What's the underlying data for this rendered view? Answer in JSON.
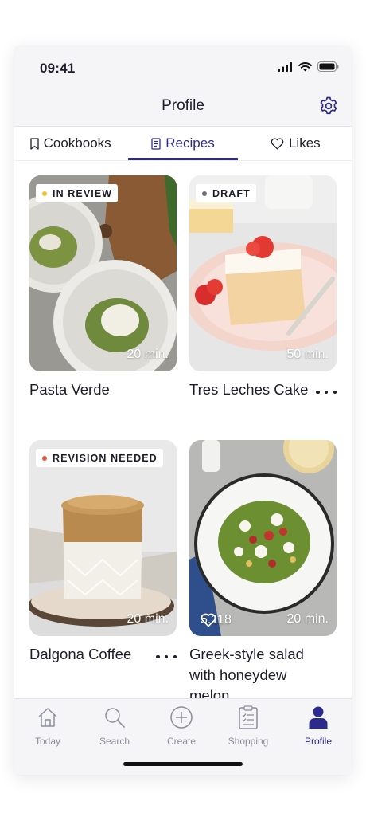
{
  "status_bar": {
    "time": "09:41"
  },
  "header": {
    "title": "Profile"
  },
  "tabs": [
    {
      "label": "Cookbooks",
      "icon": "bookmark-icon",
      "active": false
    },
    {
      "label": "Recipes",
      "icon": "recipe-book-icon",
      "active": true
    },
    {
      "label": "Likes",
      "icon": "heart-icon",
      "active": false
    }
  ],
  "recipes": [
    {
      "name": "Pasta Verde",
      "status": "IN REVIEW",
      "status_color": "#f2c230",
      "duration": "20 min.",
      "likes": ""
    },
    {
      "name": "Tres Leches Cake",
      "status": "DRAFT",
      "status_color": "#6b6b76",
      "duration": "50 min.",
      "likes": ""
    },
    {
      "name": "Dalgona Coffee",
      "status": "REVISION NEEDED",
      "status_color": "#e0543f",
      "duration": "20 min.",
      "likes": ""
    },
    {
      "name": "Greek-style salad with honeydew melon",
      "status": "",
      "status_color": "",
      "duration": "20 min.",
      "likes": "5.118"
    }
  ],
  "bottom_nav": [
    {
      "label": "Today",
      "icon": "home-icon"
    },
    {
      "label": "Search",
      "icon": "search-icon"
    },
    {
      "label": "Create",
      "icon": "plus-circle-icon"
    },
    {
      "label": "Shopping",
      "icon": "shopping-list-icon"
    },
    {
      "label": "Profile",
      "icon": "profile-icon"
    }
  ],
  "colors": {
    "accent": "#2c2a8c",
    "inactive": "#8d8d99",
    "text": "#1d1d2b"
  }
}
